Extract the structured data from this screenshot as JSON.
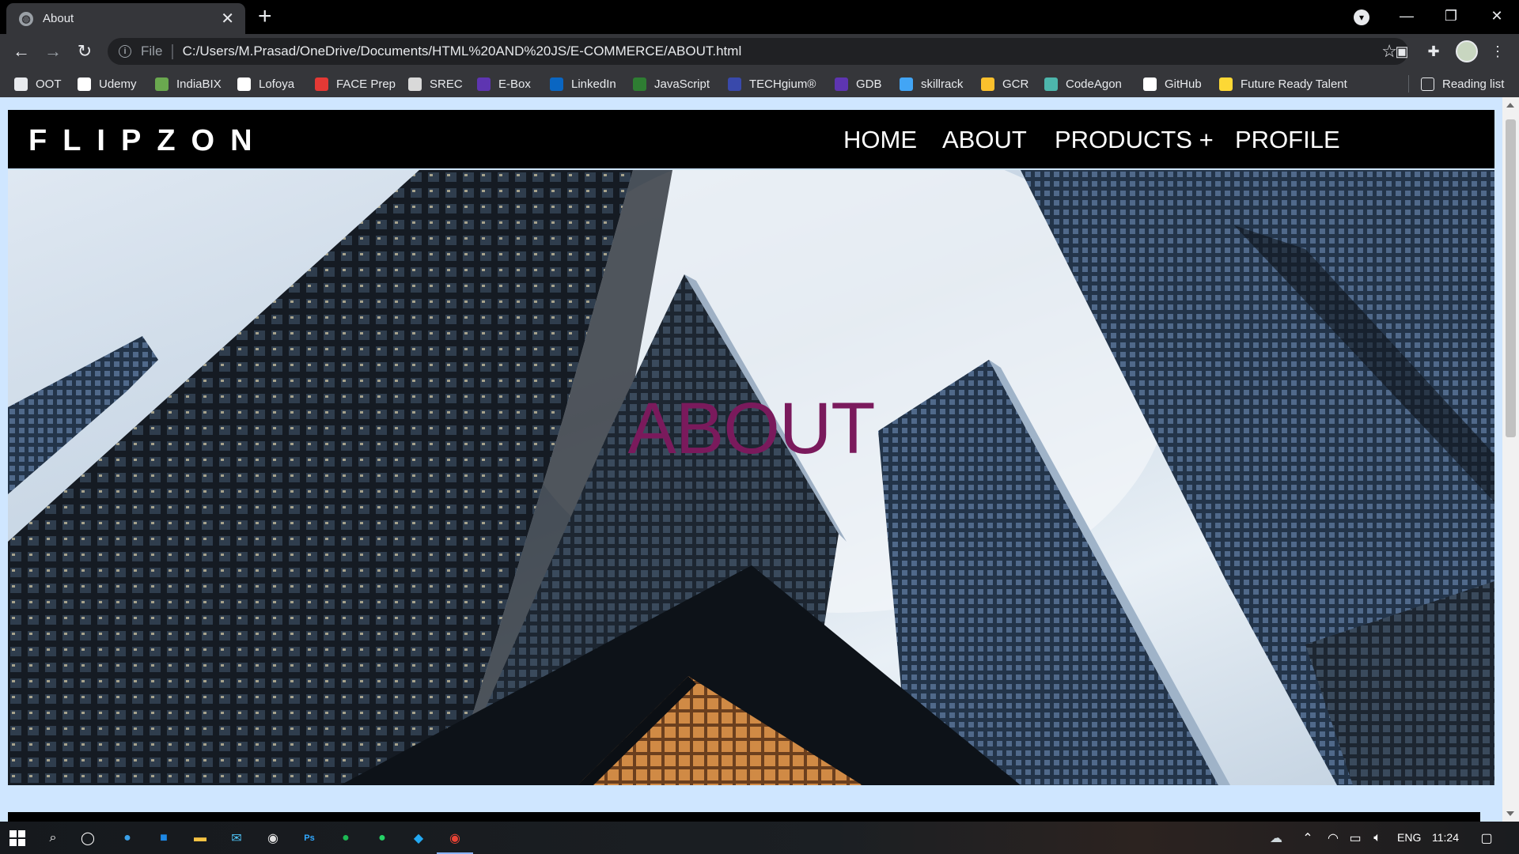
{
  "browser": {
    "tab_title": "About",
    "new_tab_label": "+",
    "url_scheme": "File",
    "url": "C:/Users/M.Prasad/OneDrive/Documents/HTML%20AND%20JS/E-COMMERCE/ABOUT.html",
    "bookmarks": [
      {
        "label": "OOT",
        "icon": "globe-icon",
        "color": "#e8eaed"
      },
      {
        "label": "Udemy",
        "icon": "udemy-icon",
        "color": "#ffffff"
      },
      {
        "label": "IndiaBIX",
        "icon": "indiabix-icon",
        "color": "#6aa84f"
      },
      {
        "label": "Lofoya",
        "icon": "lofoya-icon",
        "color": "#ffffff"
      },
      {
        "label": "FACE Prep",
        "icon": "faceprep-icon",
        "color": "#e53935"
      },
      {
        "label": "SREC",
        "icon": "srec-icon",
        "color": "#d9d9d9"
      },
      {
        "label": "E-Box",
        "icon": "ebox-icon",
        "color": "#5e35b1"
      },
      {
        "label": "LinkedIn",
        "icon": "linkedin-icon",
        "color": "#0a66c2"
      },
      {
        "label": "JavaScript",
        "icon": "javascript-icon",
        "color": "#2e7d32"
      },
      {
        "label": "TECHgium®",
        "icon": "techgium-icon",
        "color": "#3949ab"
      },
      {
        "label": "GDB",
        "icon": "gdb-icon",
        "color": "#5e35b1"
      },
      {
        "label": "skillrack",
        "icon": "skillrack-icon",
        "color": "#42a5f5"
      },
      {
        "label": "GCR",
        "icon": "classroom-icon",
        "color": "#fbc02d"
      },
      {
        "label": "CodeAgon",
        "icon": "codeagon-icon",
        "color": "#4db6ac"
      },
      {
        "label": "GitHub",
        "icon": "github-icon",
        "color": "#ffffff"
      },
      {
        "label": "Future Ready Talent",
        "icon": "future-ready-icon",
        "color": "#fdd835"
      }
    ],
    "reading_list": "Reading list"
  },
  "site": {
    "logo": "FLIPZON",
    "nav": [
      "HOME",
      "ABOUT",
      "PRODUCTS +",
      "PROFILE"
    ],
    "hero_title": "ABOUT",
    "hero_title_color": "#7a1a5c"
  },
  "taskbar": {
    "language": "ENG",
    "time": "11:24"
  }
}
